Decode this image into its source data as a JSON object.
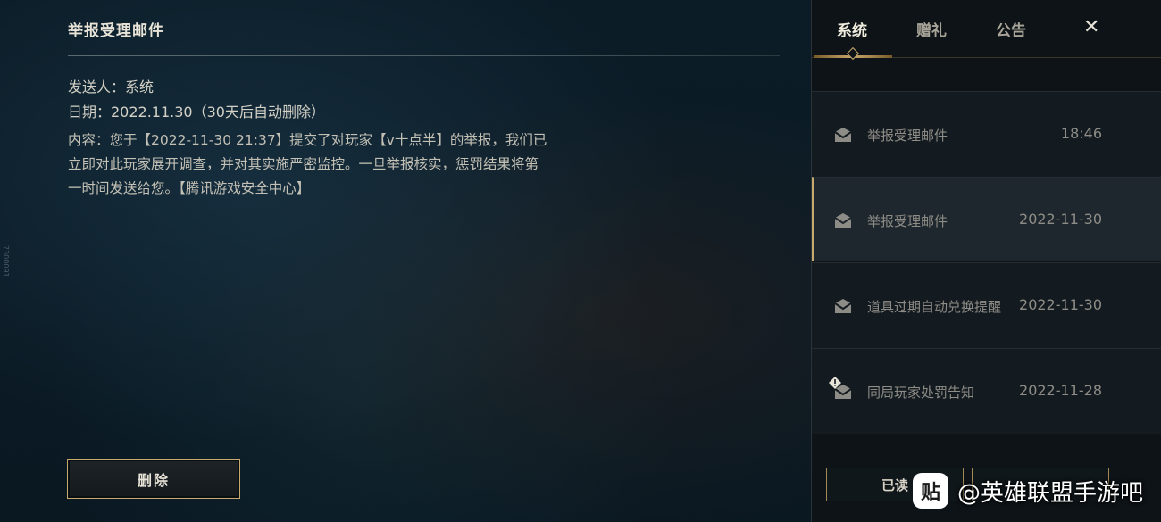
{
  "side_id": "7300091",
  "mail": {
    "title": "举报受理邮件",
    "sender": "发送人：系统",
    "date": "日期：2022.11.30（30天后自动删除）",
    "content_lines": [
      "内容：您于【2022-11-30 21:37】提交了对玩家【v十点半】的举报，我们已",
      "立即对此玩家展开调查，并对其实施严密监控。一旦举报核实，惩罚结果将第",
      "一时间发送给您。【腾讯游戏安全中心】"
    ],
    "delete_label": "删除"
  },
  "tabs": [
    {
      "label": "系统",
      "active": true
    },
    {
      "label": "赠礼",
      "active": false
    },
    {
      "label": "公告",
      "active": false
    }
  ],
  "close_label": "✕",
  "mail_list": [
    {
      "subject": "举报受理邮件",
      "time": "18:46",
      "icon": "mail-read-icon",
      "selected": false
    },
    {
      "subject": "举报受理邮件",
      "time": "2022-11-30",
      "icon": "mail-read-icon",
      "selected": true
    },
    {
      "subject": "道具过期自动兑换提醒",
      "time": "2022-11-30",
      "icon": "mail-read-icon",
      "selected": false
    },
    {
      "subject": "同局玩家处罚告知",
      "time": "2022-11-28",
      "icon": "mail-warning-icon",
      "selected": false
    }
  ],
  "bottom_buttons": {
    "read_all": "已读",
    "claim_all": ""
  },
  "watermark": {
    "logo": "贴",
    "text": "@英雄联盟手游吧"
  },
  "colors": {
    "gold": "#c8aa6e",
    "panel_bg": "#0d1317",
    "row_bg": "#141b20",
    "row_selected_bg": "#1e272d"
  }
}
